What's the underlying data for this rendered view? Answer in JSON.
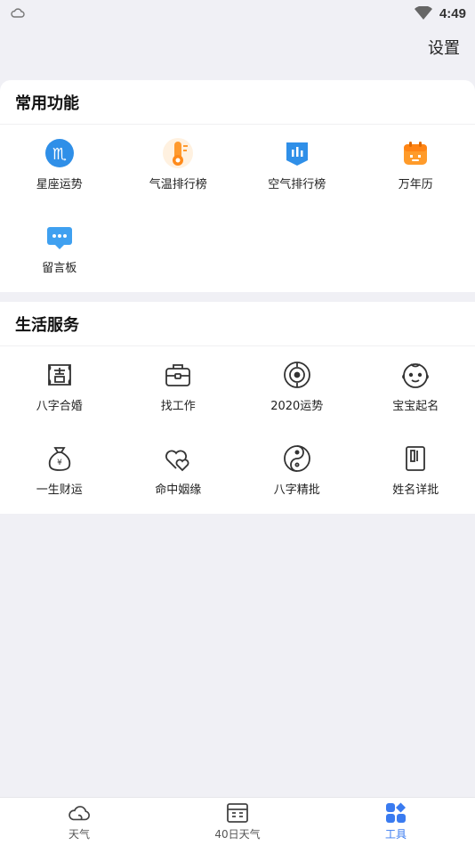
{
  "status_bar": {
    "time": "4:49"
  },
  "header": {
    "settings_label": "设置"
  },
  "common_functions": {
    "title": "常用功能",
    "items": [
      {
        "label": "星座运势",
        "icon": "zodiac-icon"
      },
      {
        "label": "气温排行榜",
        "icon": "thermometer-icon"
      },
      {
        "label": "空气排行榜",
        "icon": "air-ranking-icon"
      },
      {
        "label": "万年历",
        "icon": "calendar-icon"
      },
      {
        "label": "留言板",
        "icon": "message-board-icon"
      }
    ]
  },
  "life_services": {
    "title": "生活服务",
    "items": [
      {
        "label": "八字合婚",
        "icon": "ji-scroll-icon"
      },
      {
        "label": "找工作",
        "icon": "briefcase-icon"
      },
      {
        "label": "2020运势",
        "icon": "target-icon"
      },
      {
        "label": "宝宝起名",
        "icon": "baby-icon"
      },
      {
        "label": "一生财运",
        "icon": "money-bag-icon"
      },
      {
        "label": "命中姻缘",
        "icon": "hearts-icon"
      },
      {
        "label": "八字精批",
        "icon": "yin-yang-icon"
      },
      {
        "label": "姓名详批",
        "icon": "name-card-icon"
      }
    ]
  },
  "tabs": [
    {
      "label": "天气",
      "icon": "cloud-icon",
      "active": false
    },
    {
      "label": "40日天气",
      "icon": "forecast-calendar-icon",
      "active": false
    },
    {
      "label": "工具",
      "icon": "tools-grid-icon",
      "active": true
    }
  ],
  "colors": {
    "accent": "#3a7bf0",
    "background": "#f0f0f5",
    "card": "#ffffff"
  }
}
